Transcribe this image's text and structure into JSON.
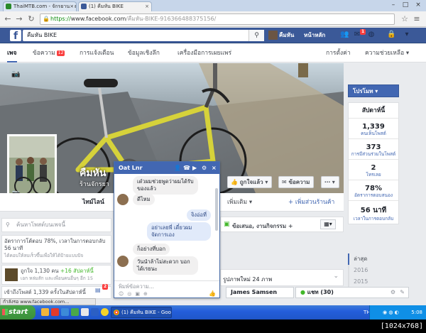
{
  "browser": {
    "tabs": [
      {
        "label": "ThaiMTB.com - จักรยาน - ผ..."
      },
      {
        "label": "(1) คืมหัน BIKE"
      }
    ],
    "url_https": "https://",
    "url_host": "www.facebook.com",
    "url_path": "/คืมหัน-BIKE-916366488375156/"
  },
  "fb": {
    "search_value": "คืมหัน BIKE",
    "user_name": "คืมหัน",
    "home_label": "หน้าหลัก",
    "friend_badge": "1"
  },
  "pagenav": {
    "items": [
      {
        "label": "เพจ"
      },
      {
        "label": "ข้อความ"
      },
      {
        "label": "การแจ้งเตือน"
      },
      {
        "label": "ข้อมูลเชิงลึก"
      },
      {
        "label": "เครื่องมือการเผยแพร่"
      },
      {
        "label": "การตั้งค่า"
      },
      {
        "label": "ความช่วยเหลือ ▾"
      }
    ],
    "message_badge": "12"
  },
  "cover": {
    "name": "คืมหัน",
    "subtitle": "ร้านจักรยา",
    "like_label": "ถูกใจแล้ว ▾",
    "message_label": "ข้อความ",
    "more_label": "⋯ ▾"
  },
  "timeline_tabs": {
    "timeline": "ไทม์ไลน์",
    "more": "เพิ่มเติม ▾",
    "add_section": "+ เพิ่มส่วนร้านค้า"
  },
  "left": {
    "search_placeholder": "ค้นหาโพสต์บนเพจนี้",
    "card1_text": "อัตราการโต้ตอบ 78%, เวลาในการตอบกลับ 56 นาที",
    "card1_sub": "ได้คอบให้ลบเร็วขึ้นเพื่อให้ได้ป้ายแบบปัจ",
    "card2_text": "ถูกใจ 1,130 คน",
    "card2_green": "+16 สัปดาห์นี้",
    "card2_sub": "เอก หล่มสัก และเพื่อนคนอื่นๆ อีก 15",
    "card3_text": "เข้าถึงโพสต์ 1,339 ครั้งในสัปดาห์นี้"
  },
  "mid": {
    "offer_label": "ข้อเสนอ, งานกิจกรรม +",
    "photos_label": "รูปภาพใหม่ 24 ภาพ"
  },
  "sidebar": {
    "promote": "โปรโมท ▾",
    "week": "สัปดาห์นี้",
    "stats": [
      {
        "n": "1,339",
        "l": "คนเห็นโพสต์"
      },
      {
        "n": "373",
        "l": "การมีส่วนร่วมในโพสต์"
      },
      {
        "n": "2",
        "l": "โทรเลย"
      },
      {
        "n": "78%",
        "l": "อัตราการตอบสนอง"
      },
      {
        "n": "56 นาที",
        "l": "เวลาในการตอบกลับ"
      }
    ],
    "years": [
      "ล่าสุด",
      "2016",
      "2015"
    ]
  },
  "chat": {
    "name": "Oat Lnr",
    "messages": [
      {
        "dir": "in",
        "text": "เด๋วผมช่วยพูดว่าผมได้รับของแล้ว"
      },
      {
        "dir": "in",
        "text": "ดีไหม"
      },
      {
        "dir": "out",
        "text": "จิงอ่อที่"
      },
      {
        "dir": "out",
        "text": "อย่าเลยพี่ เดี๋ยวผมจัดการเอง"
      },
      {
        "dir": "in",
        "text": "ก็อย่างที่บอก"
      },
      {
        "dir": "in",
        "text": "วันนำล้าไม่สะดวก บอกได้เรยนะ"
      }
    ],
    "input_placeholder": "พิมพ์ข้อความ...",
    "dock_person": "James Samsen",
    "dock_chat": "แชท (30)",
    "dock_count": "2"
  },
  "status": "กำลังรอ www.facebook.com...",
  "taskbar": {
    "start": "start",
    "task": "(1) คืมหัน BIKE - Goo...",
    "lang": "TH",
    "clock": "5:08"
  },
  "watermark": "[1024x768] https://upic.me/",
  "colors": {
    "fb_blue": "#3b5998",
    "accent": "#4267b2",
    "badge": "#fa3e3e"
  }
}
